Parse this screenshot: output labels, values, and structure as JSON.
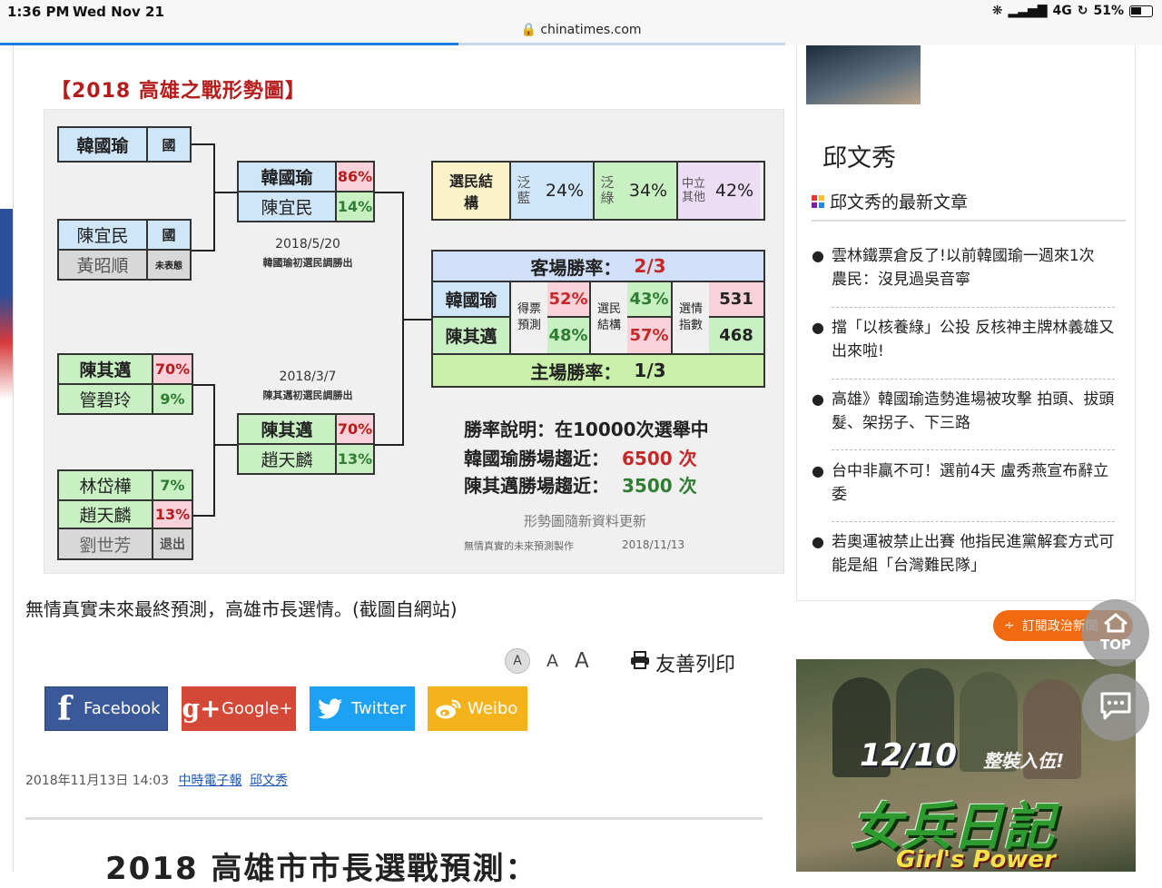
{
  "status_bar": {
    "time": "1:36 PM",
    "date": "Wed Nov 21",
    "url": "chinatimes.com",
    "network": "4G",
    "battery": "51%"
  },
  "figure": {
    "title": "【2018 高雄之戰形勢圖】",
    "primary_ksm": {
      "r1": {
        "name": "韓國瑜",
        "tag": "國"
      },
      "r2": {
        "name": "陳宜民",
        "tag": "國"
      },
      "r3": {
        "name": "黃昭順",
        "tag": "未表態"
      },
      "final_a": {
        "name": "韓國瑜",
        "pct": "86%"
      },
      "final_b": {
        "name": "陳宜民",
        "pct": "14%"
      },
      "note_date": "2018/5/20",
      "note_text": "韓國瑜初選民調勝出"
    },
    "primary_dpp": {
      "r1": {
        "name": "陳其邁",
        "pct": "70%"
      },
      "r2": {
        "name": "管碧玲",
        "pct": "9%"
      },
      "r3": {
        "name": "林岱樺",
        "pct": "7%"
      },
      "r4": {
        "name": "趙天麟",
        "pct": "13%"
      },
      "r5": {
        "name": "劉世芳",
        "tag": "退出"
      },
      "final_a": {
        "name": "陳其邁",
        "pct": "70%"
      },
      "final_b": {
        "name": "趙天麟",
        "pct": "13%"
      },
      "note_date": "2018/3/7",
      "note_text": "陳其邁初選民調勝出"
    },
    "structure": {
      "label": "選民結構",
      "blue_label": "泛藍",
      "blue_pct": "24%",
      "green_label": "泛綠",
      "green_pct": "34%",
      "neutral_label": "中立其他",
      "neutral_pct": "42%"
    },
    "matchup": {
      "away_rate_label": "客場勝率：",
      "away_rate": "2/3",
      "home_rate_label": "主場勝率：",
      "home_rate": "1/3",
      "cand_a": "韓國瑜",
      "cand_b": "陳其邁",
      "vote_label": "得票預測",
      "vote_a": "52%",
      "vote_b": "48%",
      "struct_label": "選民結構",
      "struct_a": "43%",
      "struct_b": "57%",
      "idx_label": "選情指數",
      "idx_a": "531",
      "idx_b": "468"
    },
    "explain": {
      "line1": "勝率說明：在10000次選舉中",
      "line2_label": "韓國瑜勝場趨近：",
      "line2_value": "6500 次",
      "line3_label": "陳其邁勝場趨近：",
      "line3_value": "3500 次",
      "update_note": "形勢圖隨新資料更新",
      "credit": "無情真實的未來預測製作",
      "credit_date": "2018/11/13"
    }
  },
  "caption": "無情真實未來最終預測，高雄市長選情。(截圖自網站)",
  "fontsize": {
    "small": "A",
    "medium": "A",
    "large": "A"
  },
  "print_label": "友善列印",
  "share": {
    "facebook": "Facebook",
    "google": "Google+",
    "twitter": "Twitter",
    "weibo": "Weibo",
    "colors": {
      "facebook": "#3b5998",
      "google": "#d34836",
      "twitter": "#1da1f2",
      "weibo": "#f5b31b"
    }
  },
  "meta": {
    "datetime": "2018年11月13日 14:03",
    "source": "中時電子報",
    "author": "邱文秀"
  },
  "article_heading_partial": "2018 高雄市市長選戰預測：",
  "sidebar": {
    "author_name": "邱文秀",
    "latest_label": "邱文秀的最新文章",
    "articles": [
      "雲林鐵票倉反了!以前韓國瑜一週來1次 農民：沒見過吳音寧",
      "擋「以核養綠」公投 反核神主牌林義雄又出來啦!",
      "高雄》韓國瑜造勢進場被攻擊 拍頭、拔頭髮、架拐子、下三路",
      "台中非贏不可！選前4天 盧秀燕宣布辭立委",
      "若奧運被禁止出賽 他指民進黨解套方式可能是組「台灣難民隊」"
    ],
    "subscribe": "訂閱政治新聞",
    "top_label": "TOP"
  },
  "ad": {
    "date": "12/10",
    "tagline": "整裝入伍!",
    "title": "女兵日記",
    "subtitle": "Girl's Power"
  }
}
